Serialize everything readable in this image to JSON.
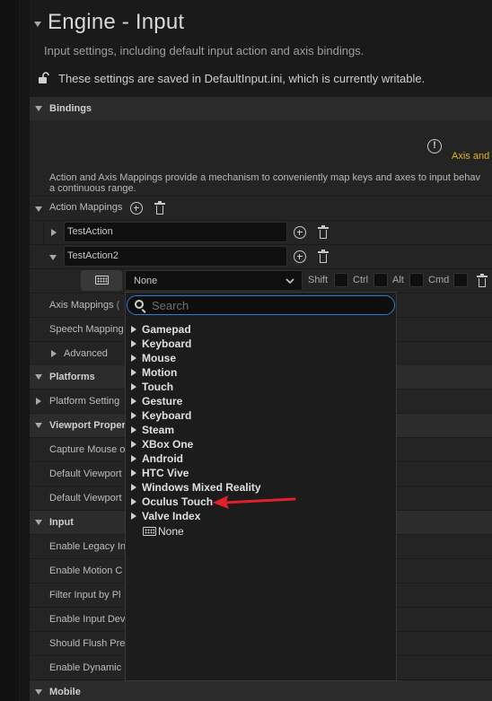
{
  "header": {
    "title": "Engine - Input",
    "subtitle": "Input settings, including default input action and axis bindings.",
    "save_note": "These settings are saved in DefaultInput.ini, which is currently writable."
  },
  "bindings": {
    "section_label": "Bindings",
    "axis_note": "Axis and",
    "description_line1": "Action and Axis Mappings provide a mechanism to conveniently map keys and axes to input behav",
    "description_line2": "a continuous range.",
    "action_mappings_label": "Action Mappings",
    "actions": [
      {
        "name": "TestAction"
      },
      {
        "name": "TestAction2"
      }
    ],
    "key_selector_value": "None",
    "modifiers": {
      "shift": "Shift",
      "ctrl": "Ctrl",
      "alt": "Alt",
      "cmd": "Cmd"
    },
    "axis_mappings_label": "Axis Mappings",
    "axis_mappings_paren": "(",
    "speech_mappings_label": "Speech Mapping",
    "advanced_label": "Advanced"
  },
  "platforms": {
    "section_label": "Platforms",
    "settings_label": "Platform Setting"
  },
  "viewport": {
    "section_label": "Viewport Propert",
    "rows": [
      "Capture Mouse o",
      "Default Viewport",
      "Default Viewport"
    ]
  },
  "input_section": {
    "section_label": "Input",
    "rows": [
      "Enable Legacy In",
      "Enable Motion C",
      "Filter Input by Pl",
      "Enable Input Dev",
      "Should Flush Pre",
      "Enable Dynamic"
    ]
  },
  "mobile": {
    "section_label": "Mobile"
  },
  "dropdown": {
    "search_placeholder": "Search",
    "categories": [
      "Gamepad",
      "Keyboard",
      "Mouse",
      "Motion",
      "Touch",
      "Gesture",
      "Keyboard",
      "Steam",
      "XBox One",
      "Android",
      "HTC Vive",
      "Windows Mixed Reality",
      "Oculus Touch",
      "Valve Index"
    ],
    "none_item": "None",
    "highlighted_item": "Oculus Touch",
    "arrow_color": "#e0202a"
  },
  "colors": {
    "accent_focus": "#2f7dd0",
    "warning_text": "#e0b41a"
  }
}
